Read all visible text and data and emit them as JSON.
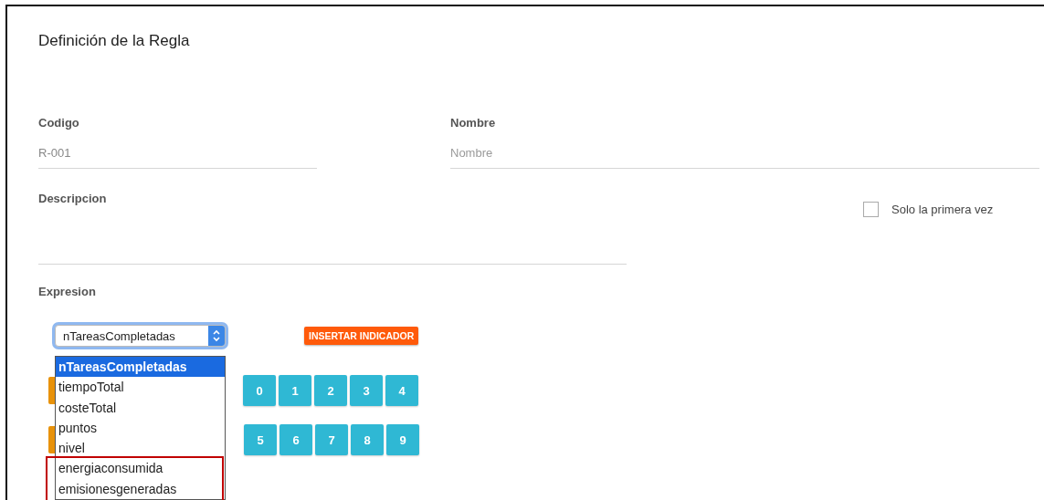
{
  "title": "Definición de la Regla",
  "codigo": {
    "label": "Codigo",
    "value": "R-001"
  },
  "nombre": {
    "label": "Nombre",
    "placeholder": "Nombre"
  },
  "descripcion": {
    "label": "Descripcion"
  },
  "solo_primera_vez": {
    "label": "Solo la primera vez",
    "checked": false
  },
  "expresion": {
    "label": "Expresion",
    "select": {
      "value": "nTareasCompletadas",
      "open": true
    },
    "insert_button": "INSERTAR INDICADOR",
    "options": [
      {
        "label": "nTareasCompletadas",
        "selected": true,
        "annotated": false
      },
      {
        "label": "tiempoTotal",
        "selected": false,
        "annotated": false
      },
      {
        "label": "costeTotal",
        "selected": false,
        "annotated": false
      },
      {
        "label": "puntos",
        "selected": false,
        "annotated": false
      },
      {
        "label": "nivel",
        "selected": false,
        "annotated": false
      },
      {
        "label": "energiaconsumida",
        "selected": false,
        "annotated": true
      },
      {
        "label": "emisionesgeneradas",
        "selected": false,
        "annotated": true
      }
    ],
    "key_rows": [
      [
        "0",
        "1",
        "2",
        "3",
        "4"
      ],
      [
        "5",
        "6",
        "7",
        "8",
        "9"
      ]
    ]
  }
}
